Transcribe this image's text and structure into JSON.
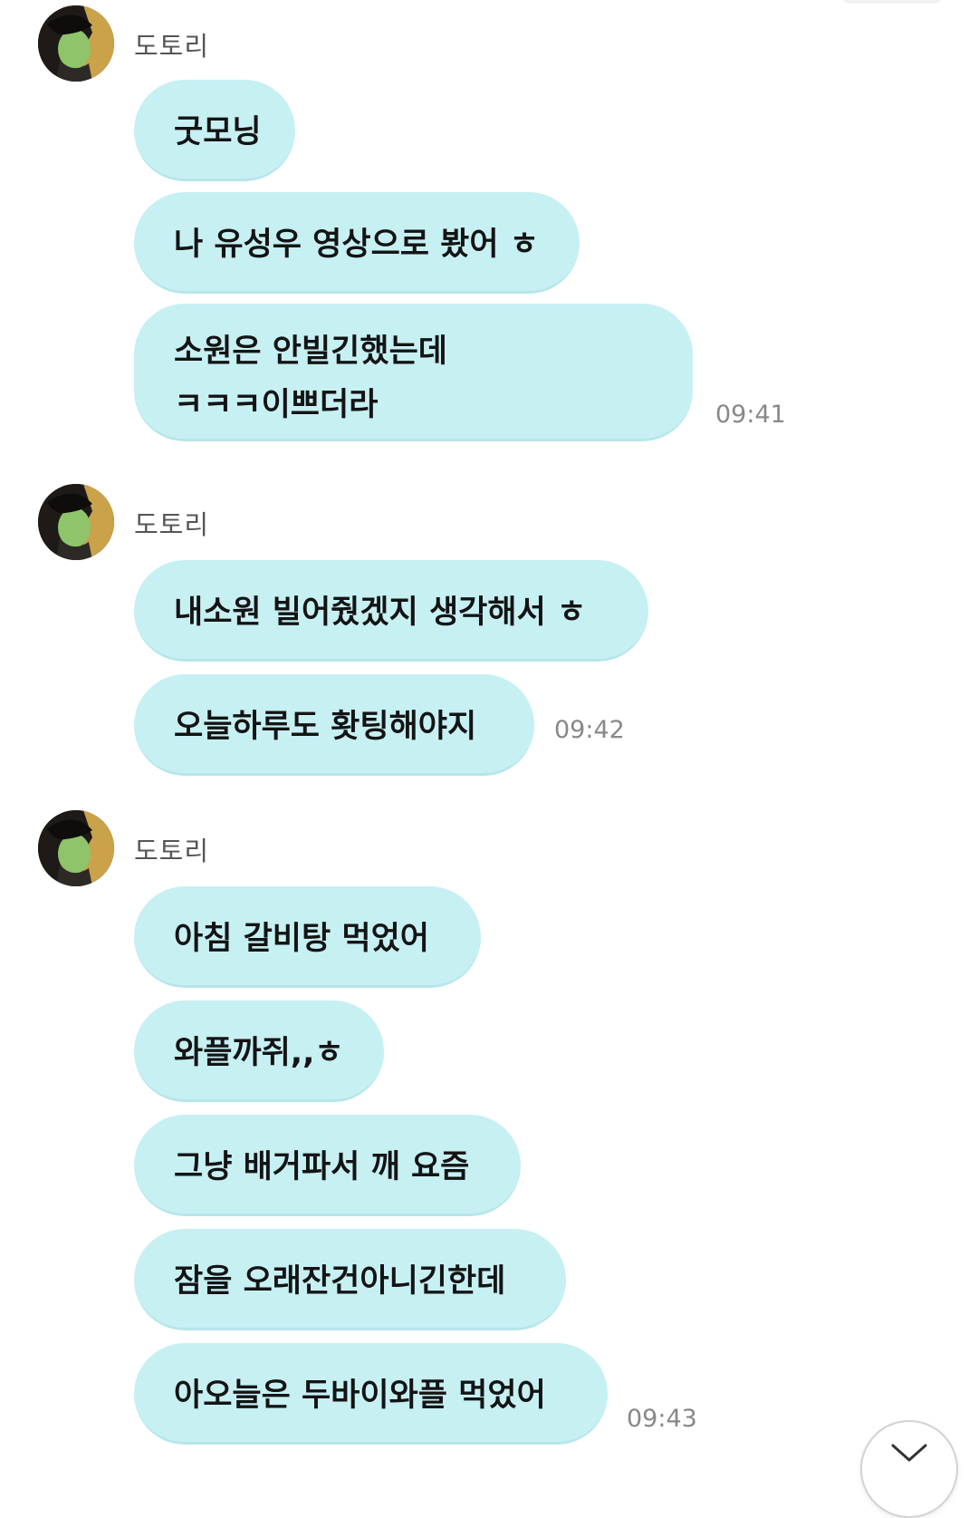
{
  "chat": {
    "groups": [
      {
        "sender": "도토리",
        "messages": [
          {
            "text": "굿모닝"
          },
          {
            "text": "나 유성우 영상으로 봤어 ㅎ"
          },
          {
            "lines": [
              "소원은 안빌긴했는데",
              "ㅋㅋㅋ이쁘더라"
            ]
          }
        ],
        "time": "09:41"
      },
      {
        "sender": "도토리",
        "messages": [
          {
            "text": "내소원 빌어줬겠지 생각해서 ㅎ"
          },
          {
            "text": "오늘하루도 홧팅해야지"
          }
        ],
        "time": "09:42"
      },
      {
        "sender": "도토리",
        "messages": [
          {
            "text": "아침 갈비탕 먹었어"
          },
          {
            "text": "와플까쥐,,ㅎ"
          },
          {
            "text": "그냥 배거파서 깨 요즘"
          },
          {
            "text": "잠을 오래잔건아니긴한데"
          },
          {
            "text": "아오늘은 두바이와플 먹었어"
          }
        ],
        "time": "09:43"
      }
    ]
  },
  "scroll_button": {
    "icon": "chevron-down-icon"
  },
  "colors": {
    "bubble_background": "#c7f0f3",
    "bubble_text": "#141414",
    "sender_name": "#555555",
    "timestamp": "#888888",
    "background": "#ffffff"
  }
}
